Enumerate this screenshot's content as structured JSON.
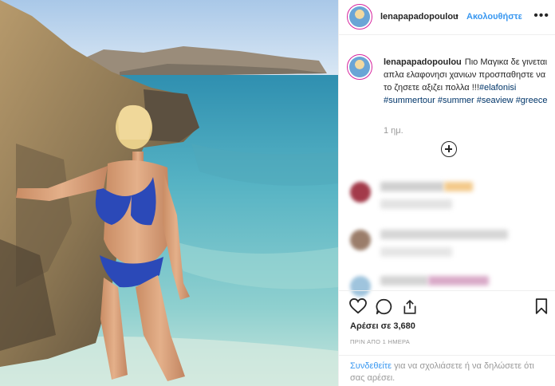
{
  "post": {
    "username": "lenapapadopoulou",
    "follow_label": "Ακολουθήστε",
    "more_label": "•••",
    "caption": {
      "text_plain": "Πιο Μαγικα δε γινεται απλα ελαφονησι χανιων προσπαθηστε να το ζησετε αξιζει πολλα !!!",
      "hashtags": [
        "#elafonisi",
        "#summertour",
        "#summer",
        "#seaview",
        "#greece"
      ]
    },
    "time_ago": "1 ημ.",
    "likes_text": "Αρέσει σε 3,680",
    "posted_when": "ΠΡΙΝ ΑΠΟ 1 ΗΜΕΡΑ",
    "login_prompt": {
      "link": "Συνδεθείτε",
      "rest": " για να σχολιάσετε ή να δηλώσετε ότι σας αρέσει."
    }
  },
  "icons": {
    "like": "heart-icon",
    "comment": "comment-icon",
    "share": "share-icon",
    "save": "bookmark-icon",
    "add_comment": "plus-circle-icon",
    "more": "more-options-icon"
  },
  "colors": {
    "link_blue": "#3897f0",
    "hashtag_blue": "#003569",
    "muted": "#999999",
    "text": "#262626"
  }
}
